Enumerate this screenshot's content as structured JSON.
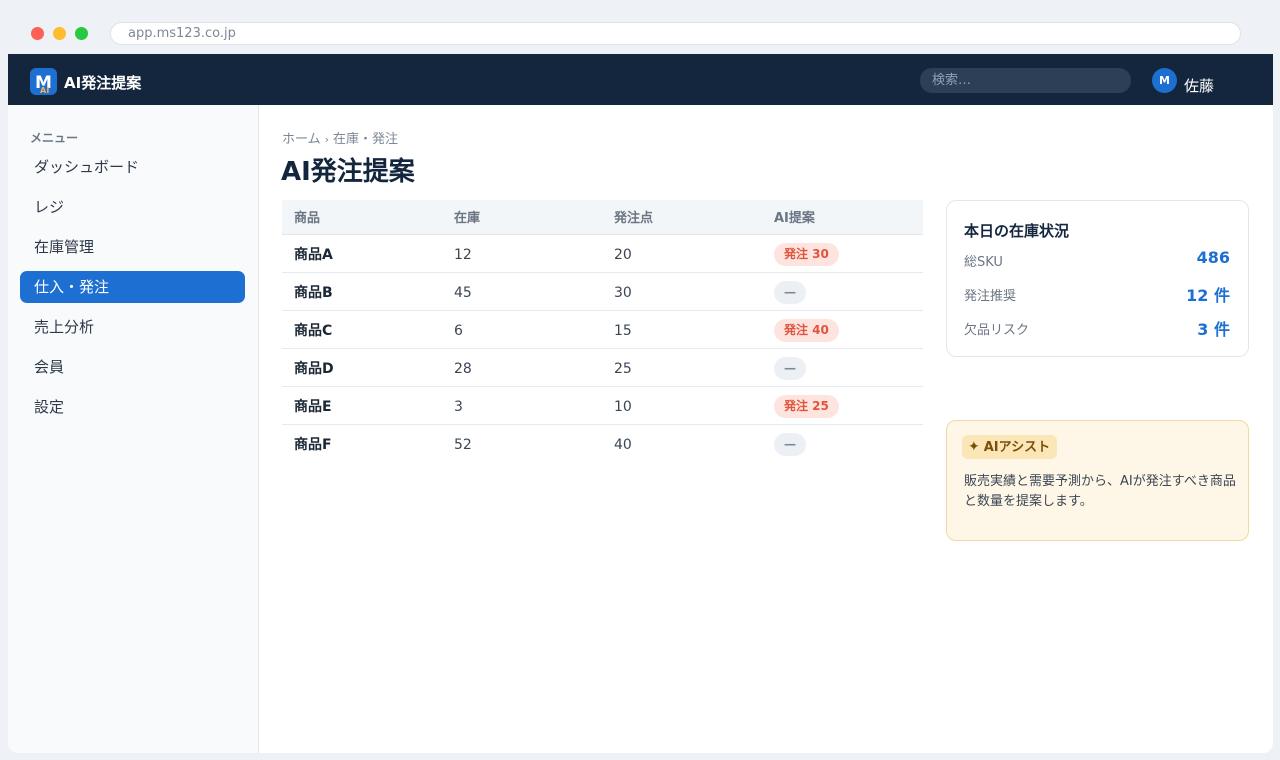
{
  "browser": {
    "url": "app.ms123.co.jp"
  },
  "header": {
    "logo_letter": "M",
    "logo_sub": "AI",
    "app_title": "AI発注提案",
    "search_placeholder": "検索…",
    "avatar_initial": "M",
    "user_name": "佐藤"
  },
  "sidebar": {
    "heading": "メニュー",
    "items": [
      {
        "label": "ダッシュボード",
        "active": false
      },
      {
        "label": "レジ",
        "active": false
      },
      {
        "label": "在庫管理",
        "active": false
      },
      {
        "label": "仕入・発注",
        "active": true
      },
      {
        "label": "売上分析",
        "active": false
      },
      {
        "label": "会員",
        "active": false
      },
      {
        "label": "設定",
        "active": false
      }
    ]
  },
  "breadcrumb": {
    "home": "ホーム",
    "separator": "›",
    "current": "在庫・発注"
  },
  "page": {
    "title": "AI発注提案"
  },
  "table": {
    "columns": [
      "商品",
      "在庫",
      "発注点",
      "AI提案"
    ],
    "rows": [
      {
        "product": "商品A",
        "stock": "12",
        "reorder_point": "20",
        "suggestion": "発注 30"
      },
      {
        "product": "商品B",
        "stock": "45",
        "reorder_point": "30",
        "suggestion": "—"
      },
      {
        "product": "商品C",
        "stock": "6",
        "reorder_point": "15",
        "suggestion": "発注 40"
      },
      {
        "product": "商品D",
        "stock": "28",
        "reorder_point": "25",
        "suggestion": "—"
      },
      {
        "product": "商品E",
        "stock": "3",
        "reorder_point": "10",
        "suggestion": "発注 25"
      },
      {
        "product": "商品F",
        "stock": "52",
        "reorder_point": "40",
        "suggestion": "—"
      }
    ]
  },
  "status_card": {
    "title": "本日の在庫状況",
    "stats": [
      {
        "label": "総SKU",
        "value": "486"
      },
      {
        "label": "発注推奨",
        "value": "12 件"
      },
      {
        "label": "欠品リスク",
        "value": "3 件"
      }
    ]
  },
  "ai_card": {
    "icon": "sparkle-icon",
    "badge_label": "AIアシスト",
    "text": "販売実績と需要予測から、AIが発注すべき商品と数量を提案します。"
  },
  "colors": {
    "topbar": "#14263d",
    "accent": "#1d6fd1",
    "order_badge_bg": "#fde4df",
    "order_badge_text": "#e0553d",
    "ai_card_bg": "#fef6e6"
  }
}
